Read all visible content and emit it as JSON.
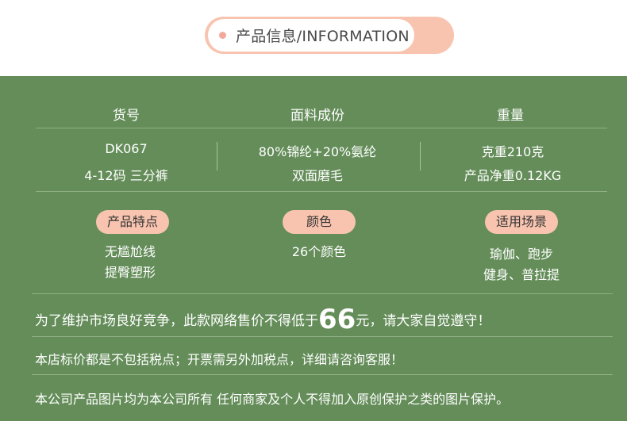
{
  "header": {
    "title": "产品信息/INFORMATION"
  },
  "specs": {
    "columns": [
      {
        "header": "货号",
        "line1": "DK067",
        "line2": "4-12码 三分裤"
      },
      {
        "header": "面料成份",
        "line1": "80%锦纶+20%氨纶",
        "line2": "双面磨毛"
      },
      {
        "header": "重量",
        "line1": "克重210克",
        "line2": "产品净重0.12KG"
      }
    ]
  },
  "features": {
    "columns": [
      {
        "badge": "产品特点",
        "line1": "无尴尬线",
        "line2": "提臀塑形"
      },
      {
        "badge": "颜色",
        "line1": "26个颜色",
        "line2": ""
      },
      {
        "badge": "适用场景",
        "line1": "瑜伽、跑步",
        "line2": "健身、普拉提"
      }
    ]
  },
  "notices": {
    "price_before": "为了维护市场良好竞争，此款网络售价不得低于",
    "price_value": "66",
    "price_after": "元，请大家自觉遵守！",
    "tax": "本店标价都是不包括税点；开票需另外加税点，详细请咨询客服！",
    "copyright": "本公司产品图片均为本公司所有 任何商家及个人不得加入原创保护之类的图片保护。"
  },
  "colors": {
    "panel": "#648d59",
    "accent": "#f8c4b0",
    "dot": "#f3a99a"
  }
}
